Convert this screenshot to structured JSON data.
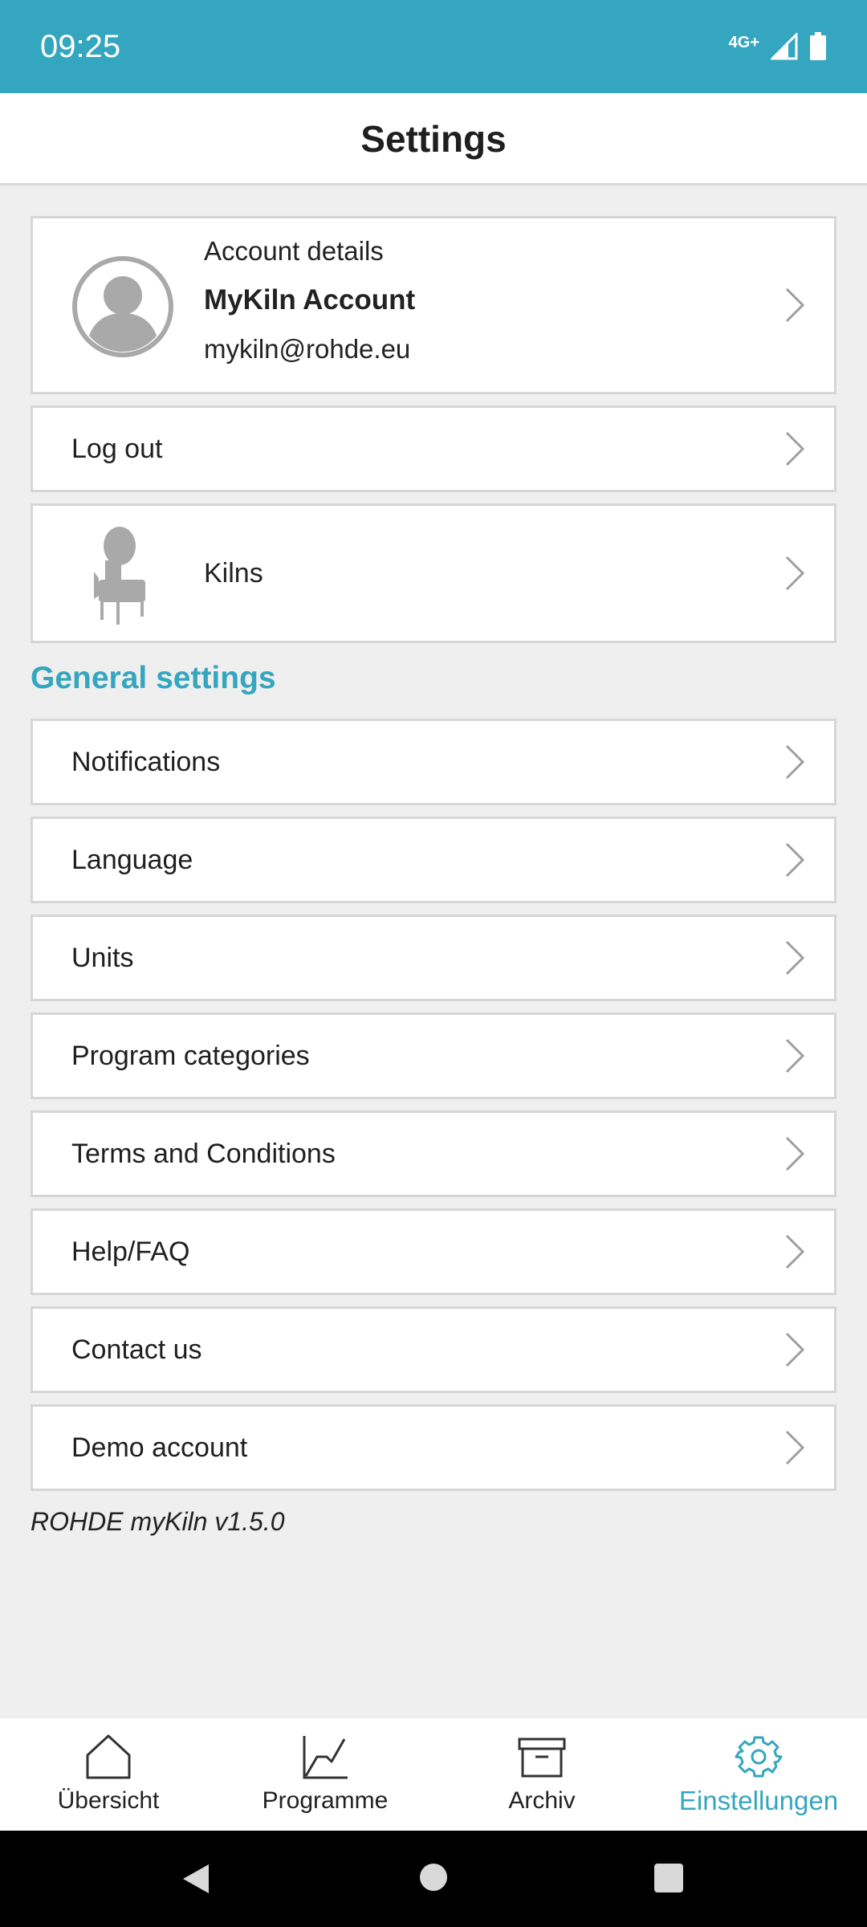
{
  "status_bar": {
    "time": "09:25",
    "network": "4G+",
    "icons": [
      "signal-icon",
      "battery-icon"
    ]
  },
  "header": {
    "title": "Settings"
  },
  "account": {
    "heading": "Account details",
    "name": "MyKiln Account",
    "email": "mykiln@rohde.eu"
  },
  "logout_label": "Log out",
  "kilns_label": "Kilns",
  "general_settings": {
    "heading": "General settings",
    "items": [
      {
        "label": "Notifications"
      },
      {
        "label": "Language"
      },
      {
        "label": "Units"
      },
      {
        "label": "Program categories"
      },
      {
        "label": "Terms and Conditions"
      },
      {
        "label": "Help/FAQ"
      },
      {
        "label": "Contact us"
      },
      {
        "label": "Demo account"
      }
    ]
  },
  "version": "ROHDE myKiln v1.5.0",
  "bottom_nav": {
    "items": [
      {
        "label": "Übersicht",
        "icon": "home-icon"
      },
      {
        "label": "Programme",
        "icon": "chart-line-icon"
      },
      {
        "label": "Archiv",
        "icon": "archive-box-icon"
      },
      {
        "label": "Einstellungen",
        "icon": "gear-icon",
        "active": true
      }
    ]
  },
  "colors": {
    "accent": "#35a6bf",
    "background": "#efefef",
    "card": "#ffffff",
    "border": "#d6d6d6"
  }
}
